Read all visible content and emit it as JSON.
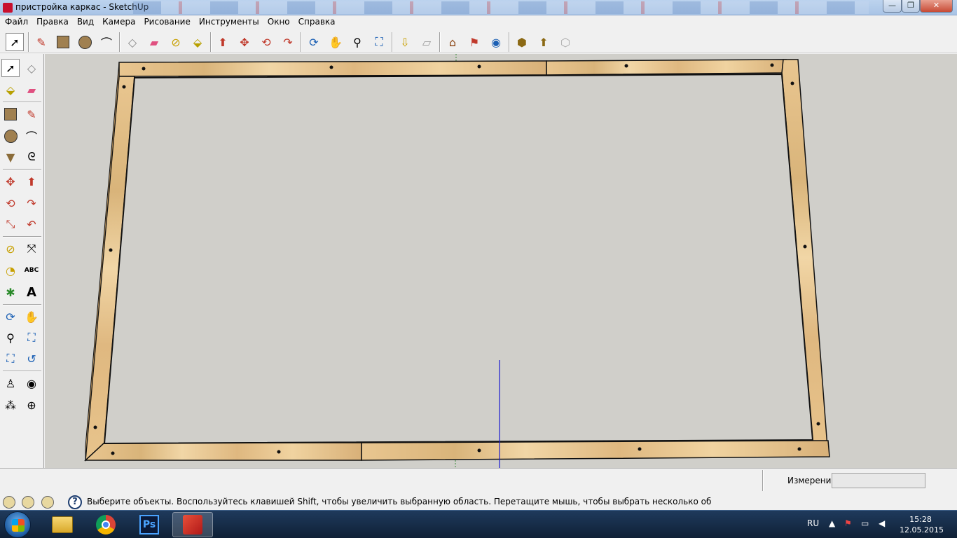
{
  "window": {
    "title": "пристройка каркас - SketchUp",
    "minimize": "—",
    "maximize": "❐",
    "close": "✕"
  },
  "menu": [
    "Файл",
    "Правка",
    "Вид",
    "Камера",
    "Рисование",
    "Инструменты",
    "Окно",
    "Справка"
  ],
  "toolbar_icons": [
    "select-icon",
    "pencil-icon",
    "rectangle-icon",
    "circle-icon",
    "arc-icon",
    "make-component-icon",
    "eraser-icon",
    "tape-measure-icon",
    "paint-bucket-icon",
    "push-pull-icon",
    "move-icon",
    "rotate-icon",
    "follow-me-icon",
    "orbit-icon",
    "pan-icon",
    "zoom-icon",
    "zoom-extents-icon",
    "get-models-icon",
    "share-model-icon",
    "share-component-icon",
    "get-photo-texture-icon",
    "send-to-layout-icon",
    "warehouse-icon",
    "components-icon",
    "export-icon",
    "preview-icon"
  ],
  "left_tools": [
    "select",
    "make-component",
    "paint-bucket",
    "eraser",
    "rectangle",
    "pencil",
    "circle",
    "arc",
    "polygon",
    "freehand",
    "move",
    "push-pull",
    "rotate",
    "follow-me",
    "scale",
    "offset",
    "tape-measure",
    "dimension",
    "protractor",
    "text",
    "axes",
    "3d-text",
    "orbit",
    "pan",
    "zoom",
    "zoom-window",
    "zoom-extents",
    "previous-view",
    "position-camera",
    "look-around",
    "walk",
    "section-plane"
  ],
  "measurements": {
    "label": "Измерения",
    "value": ""
  },
  "status": {
    "message": "Выберите объекты. Воспользуйтесь клавишей Shift, чтобы увеличить выбранную область. Перетащите мышь, чтобы выбрать несколько об",
    "help": "?"
  },
  "taskbar": {
    "language": "RU",
    "time": "15:28",
    "date": "12.05.2015",
    "apps": [
      "explorer",
      "chrome",
      "photoshop",
      "sketchup"
    ],
    "photoshop_label": "Ps"
  },
  "colors": {
    "viewport": "#d0cfca",
    "wood": "#e7c48c",
    "blue_axis": "#1a1ad0",
    "green_axis": "#3a8a3a"
  }
}
